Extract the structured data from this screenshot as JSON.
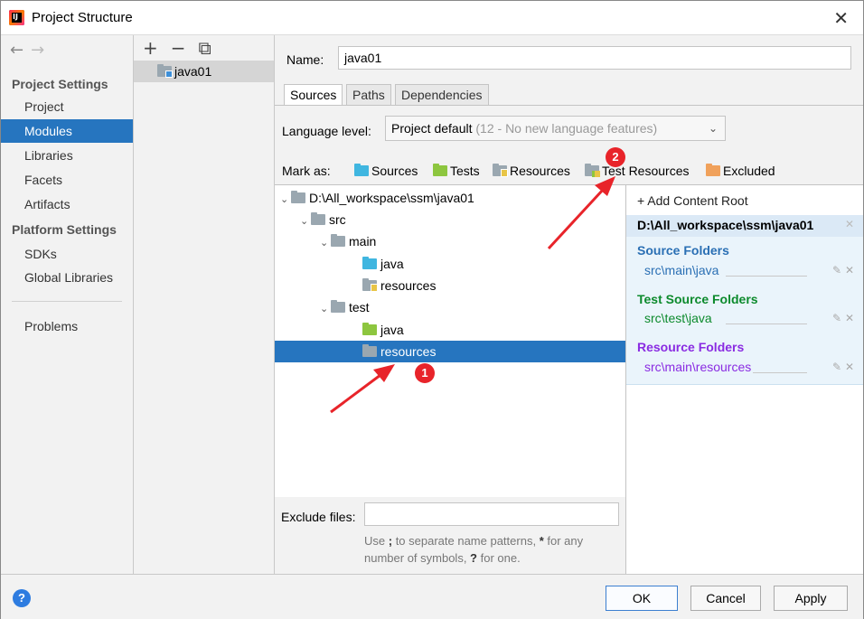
{
  "window": {
    "title": "Project Structure",
    "close_glyph": "✕"
  },
  "nav": {
    "back": "←",
    "forward": "→",
    "project_settings_label": "Project Settings",
    "platform_settings_label": "Platform Settings",
    "items": [
      "Project",
      "Modules",
      "Libraries",
      "Facets",
      "Artifacts"
    ],
    "platform_items": [
      "SDKs",
      "Global Libraries"
    ],
    "problems": "Problems",
    "selected": "Modules"
  },
  "modules": {
    "toolbar": {
      "add": "+",
      "remove": "−",
      "copy": "⧉"
    },
    "items": [
      "java01"
    ]
  },
  "module": {
    "name_label": "Name:",
    "name_value": "java01",
    "tabs": [
      "Sources",
      "Paths",
      "Dependencies"
    ],
    "active_tab": "Sources",
    "language_level_label": "Language level:",
    "language_level_value": "Project default",
    "language_level_hint": "(12 - No new language features)",
    "mark_as_label": "Mark as:",
    "mark_as": {
      "sources": "Sources",
      "tests": "Tests",
      "resources": "Resources",
      "test_resources": "Test Resources",
      "excluded": "Excluded"
    },
    "tree": [
      {
        "label": "D:\\All_workspace\\ssm\\java01",
        "level": 0,
        "icon": "folder-gray",
        "expanded": true
      },
      {
        "label": "src",
        "level": 1,
        "icon": "folder-gray",
        "expanded": true
      },
      {
        "label": "main",
        "level": 2,
        "icon": "folder-gray",
        "expanded": true
      },
      {
        "label": "java",
        "level": 3,
        "icon": "folder-source"
      },
      {
        "label": "resources",
        "level": 3,
        "icon": "folder-resources"
      },
      {
        "label": "test",
        "level": 2,
        "icon": "folder-gray",
        "expanded": true
      },
      {
        "label": "java",
        "level": 3,
        "icon": "folder-test"
      },
      {
        "label": "resources",
        "level": 3,
        "icon": "folder-gray",
        "selected": true
      }
    ],
    "exclude_label": "Exclude files:",
    "exclude_value": "",
    "exclude_hint_1": "Use ",
    "exclude_hint_semicolon": ";",
    "exclude_hint_2": " to separate name patterns, ",
    "exclude_hint_star": "*",
    "exclude_hint_3": " for any number of symbols, ",
    "exclude_hint_q": "?",
    "exclude_hint_4": " for one."
  },
  "content_roots": {
    "add_label": "+ Add Content Root",
    "root_path": "D:\\All_workspace\\ssm\\java01",
    "source_title": "Source Folders",
    "source_path": "src\\main\\java",
    "test_title": "Test Source Folders",
    "test_path": "src\\test\\java",
    "resource_title": "Resource Folders",
    "resource_path": "src\\main\\resources",
    "colors": {
      "source": "#2a6fb4",
      "test": "#0c8a2c",
      "resource": "#8a2be2"
    }
  },
  "buttons": {
    "help": "?",
    "ok": "OK",
    "cancel": "Cancel",
    "apply": "Apply"
  },
  "annotations": {
    "badge1": "1",
    "badge2": "2",
    "color": "#e8242a"
  }
}
